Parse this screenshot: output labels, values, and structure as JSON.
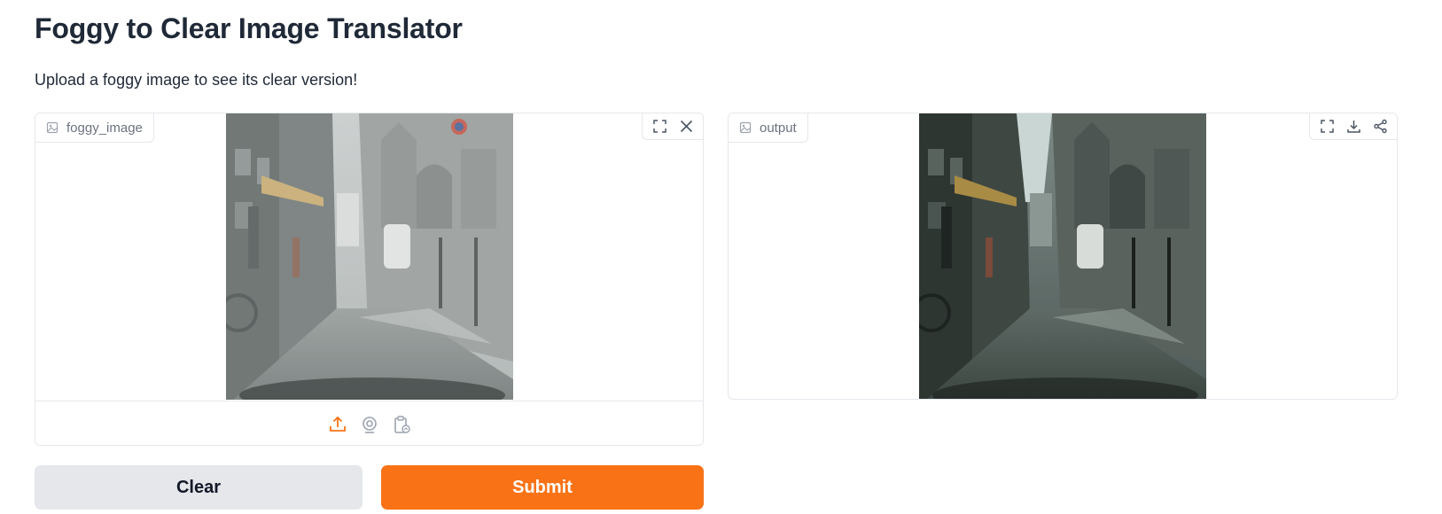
{
  "page": {
    "title": "Foggy to Clear Image Translator",
    "description": "Upload a foggy image to see its clear version!"
  },
  "input": {
    "label": "foggy_image",
    "label_icon": "image-icon",
    "toolbar_icons": [
      "fullscreen-icon",
      "close-icon"
    ],
    "source_icons": [
      "upload-icon",
      "webcam-icon",
      "clipboard-icon"
    ],
    "active_source_color": "#f97316",
    "image_content": "foggy street scene"
  },
  "output": {
    "label": "output",
    "label_icon": "image-icon",
    "toolbar_icons": [
      "fullscreen-icon",
      "download-icon",
      "share-icon"
    ],
    "image_content": "clear street scene"
  },
  "actions": {
    "clear_label": "Clear",
    "submit_label": "Submit"
  },
  "colors": {
    "accent": "#f97316",
    "secondary_button": "#e5e7eb",
    "border": "#e5e7eb"
  }
}
